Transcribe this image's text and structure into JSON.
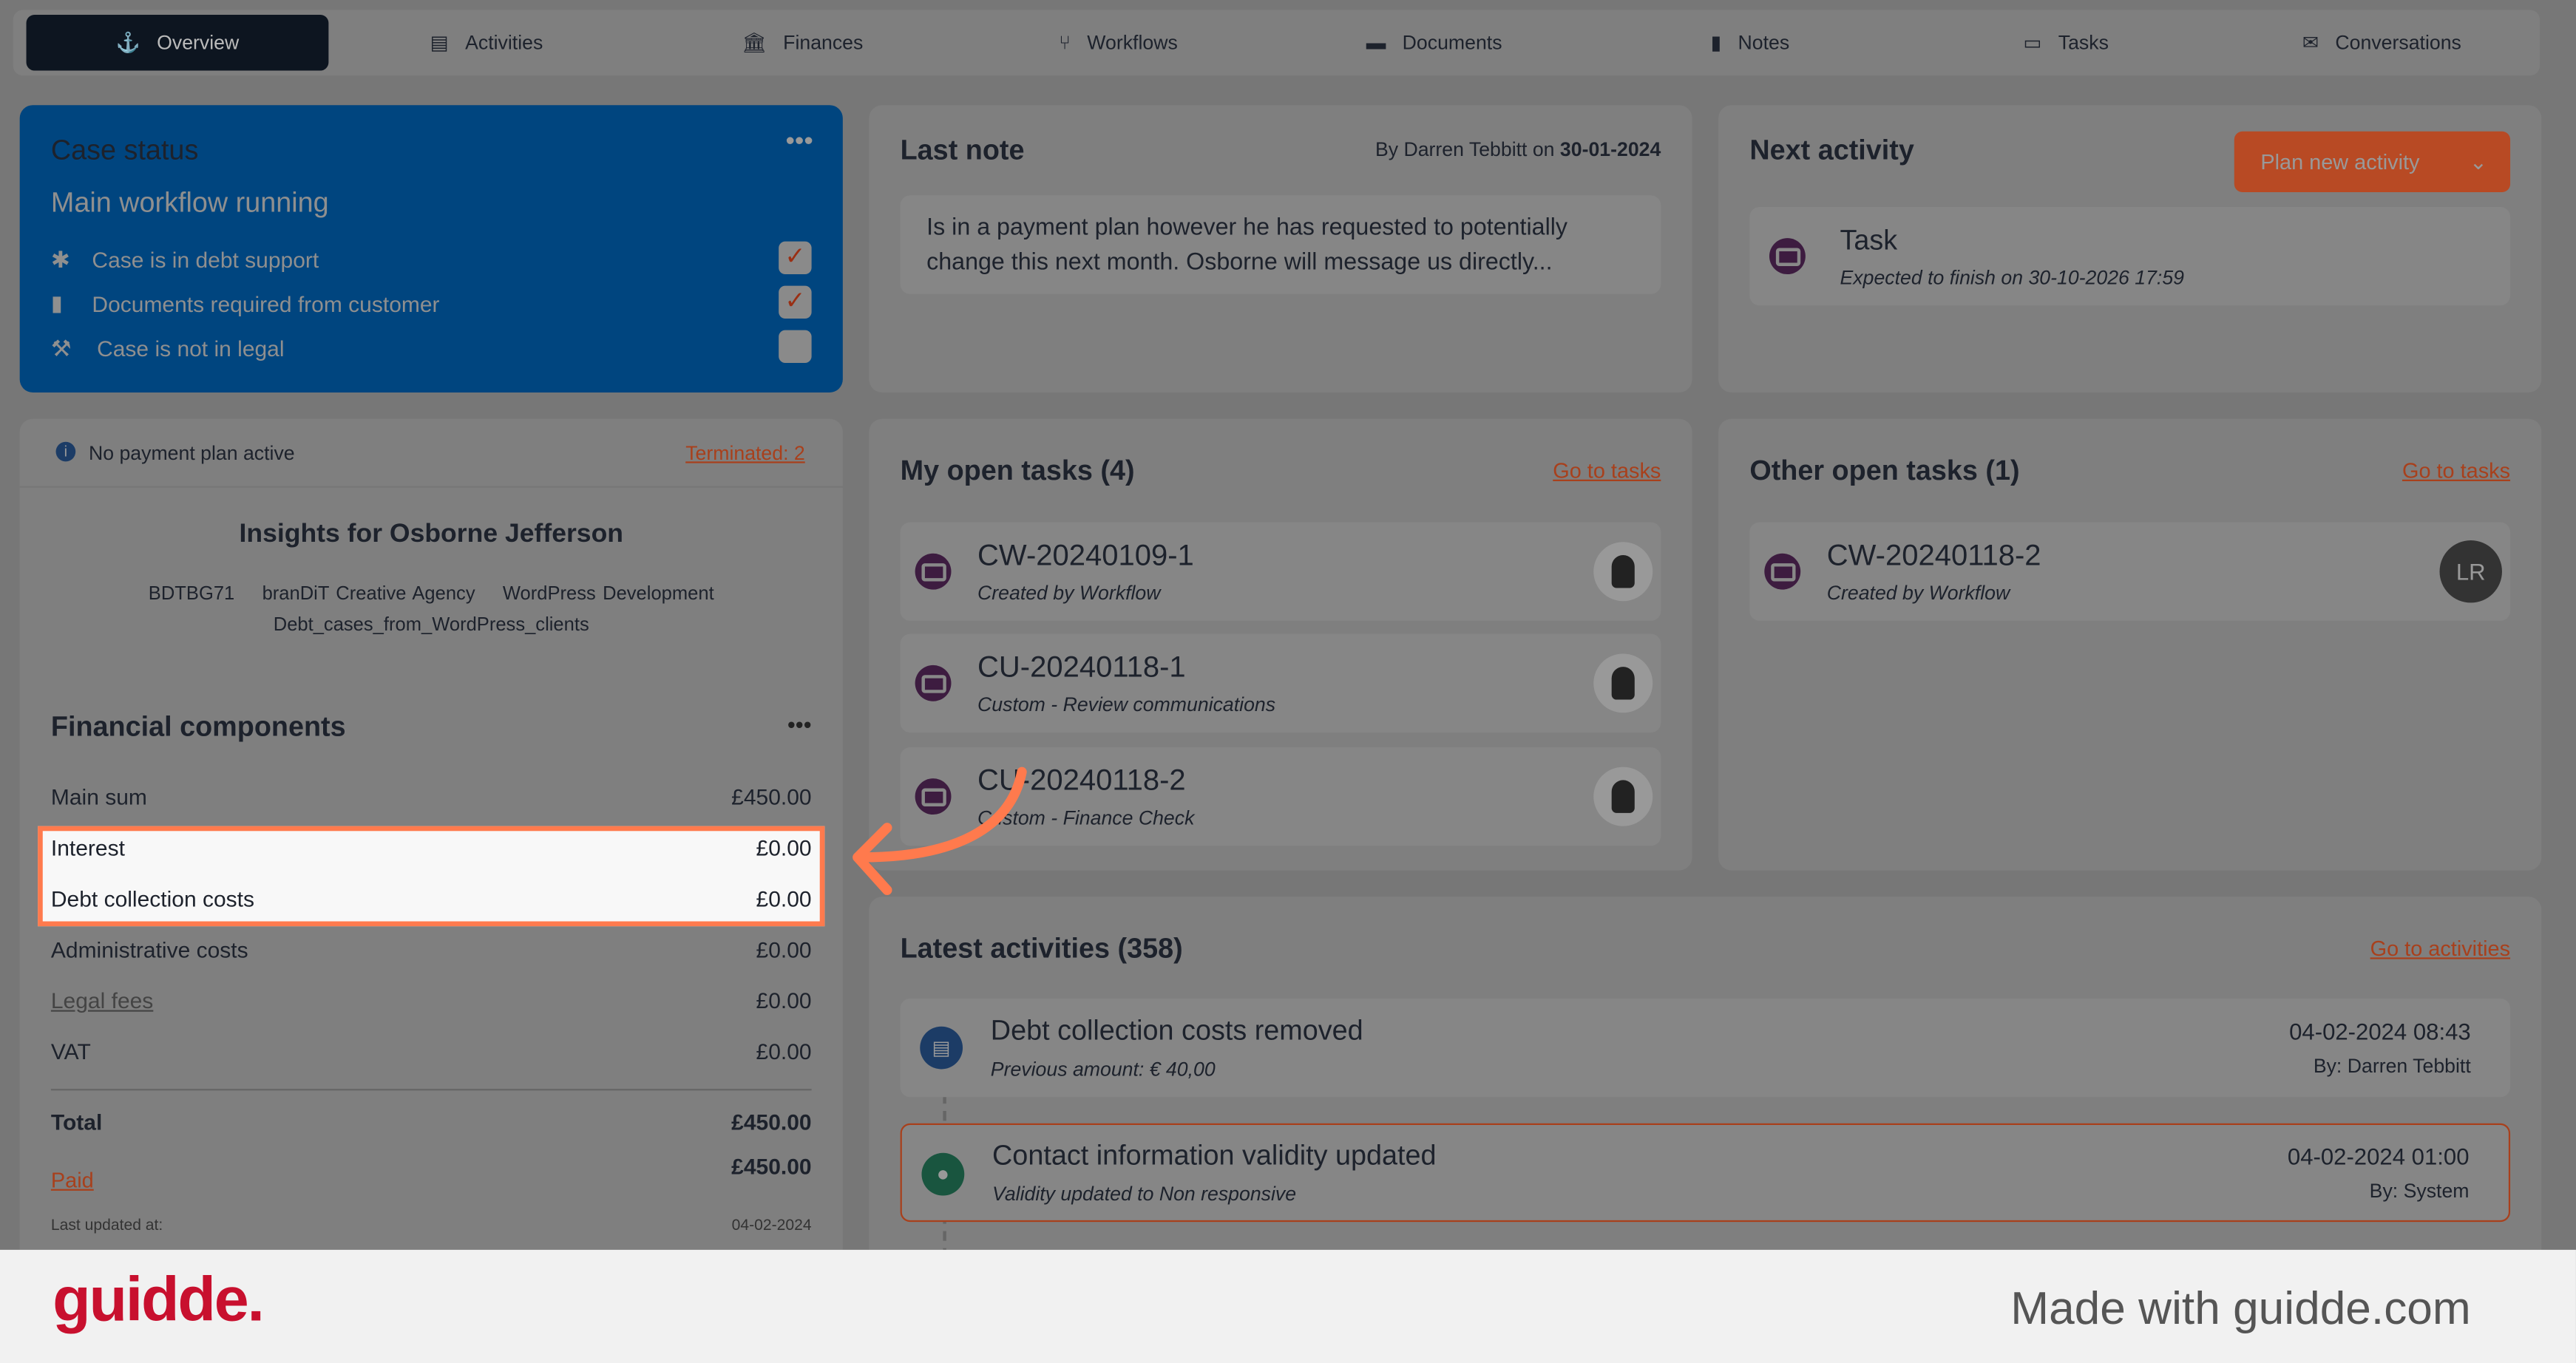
{
  "nav": {
    "tabs": [
      {
        "label": "Overview",
        "icon": "anchor-icon"
      },
      {
        "label": "Activities",
        "icon": "file-icon"
      },
      {
        "label": "Finances",
        "icon": "bank-icon"
      },
      {
        "label": "Workflows",
        "icon": "branch-icon"
      },
      {
        "label": "Documents",
        "icon": "folder-icon"
      },
      {
        "label": "Notes",
        "icon": "clipboard-icon"
      },
      {
        "label": "Tasks",
        "icon": "ticket-icon"
      },
      {
        "label": "Conversations",
        "icon": "envelope-icon"
      }
    ],
    "active": "Overview"
  },
  "case_status": {
    "title": "Case status",
    "workflow": "Main workflow running",
    "items": [
      {
        "label": "Case is in debt support",
        "checked": true
      },
      {
        "label": "Documents required from customer",
        "checked": true
      },
      {
        "label": "Case is not in legal",
        "checked": false
      }
    ],
    "check_mark": "✓"
  },
  "payment": {
    "text": "No payment plan active",
    "terminated": "Terminated: 2"
  },
  "insights": {
    "title": "Insights for Osborne Jefferson",
    "tags": [
      "BDTBG71",
      "branDiT Creative Agency",
      "WordPress Development"
    ],
    "tag2": "Debt_cases_from_WordPress_clients"
  },
  "financial": {
    "title": "Financial components",
    "rows": [
      {
        "label": "Main sum",
        "value": "£450.00"
      },
      {
        "label": "Interest",
        "value": "£0.00"
      },
      {
        "label": "Debt collection costs",
        "value": "£0.00"
      },
      {
        "label": "Administrative costs",
        "value": "£0.00"
      },
      {
        "label": "Legal fees",
        "value": "£0.00"
      },
      {
        "label": "VAT",
        "value": "£0.00"
      }
    ],
    "total_label": "Total",
    "total_value": "£450.00",
    "paid_label": "Paid",
    "paid_value": "£450.00",
    "updated_label": "Last updated at:",
    "updated_value": "04-02-2024"
  },
  "last_note": {
    "title": "Last note",
    "by_prefix": "By Darren Tebbitt on",
    "date": "30-01-2024",
    "text": "Is in a payment plan however he has requested to potentially change this next month. Osborne will message us directly..."
  },
  "next_activity": {
    "title": "Next activity",
    "button": "Plan new activity",
    "task_title": "Task",
    "task_sub": "Expected to finish on 30-10-2026 17:59"
  },
  "my_tasks": {
    "title": "My open tasks (4)",
    "link": "Go to tasks",
    "items": [
      {
        "id": "CW-20240109-1",
        "sub": "Created by Workflow"
      },
      {
        "id": "CU-20240118-1",
        "sub": "Custom - Review communications"
      },
      {
        "id": "CU-20240118-2",
        "sub": "Custom - Finance Check"
      }
    ]
  },
  "other_tasks": {
    "title": "Other open tasks (1)",
    "link": "Go to tasks",
    "items": [
      {
        "id": "CW-20240118-2",
        "sub": "Created by Workflow",
        "avatar": "LR"
      }
    ]
  },
  "activities": {
    "title": "Latest activities (358)",
    "link": "Go to activities",
    "items": [
      {
        "title": "Debt collection costs removed",
        "sub": "Previous amount: € 40,00",
        "date": "04-02-2024 08:43",
        "by": "By: Darren Tebbitt"
      },
      {
        "title": "Contact information validity updated",
        "sub": "Validity updated to Non responsive",
        "date": "04-02-2024 01:00",
        "by": "By: System"
      }
    ]
  },
  "footer": {
    "logo": "guidde.",
    "made_with": "Made with guidde.com"
  },
  "colors": {
    "accent": "#ff7a4d",
    "blue": "#00457f",
    "brand": "#c8102e"
  }
}
